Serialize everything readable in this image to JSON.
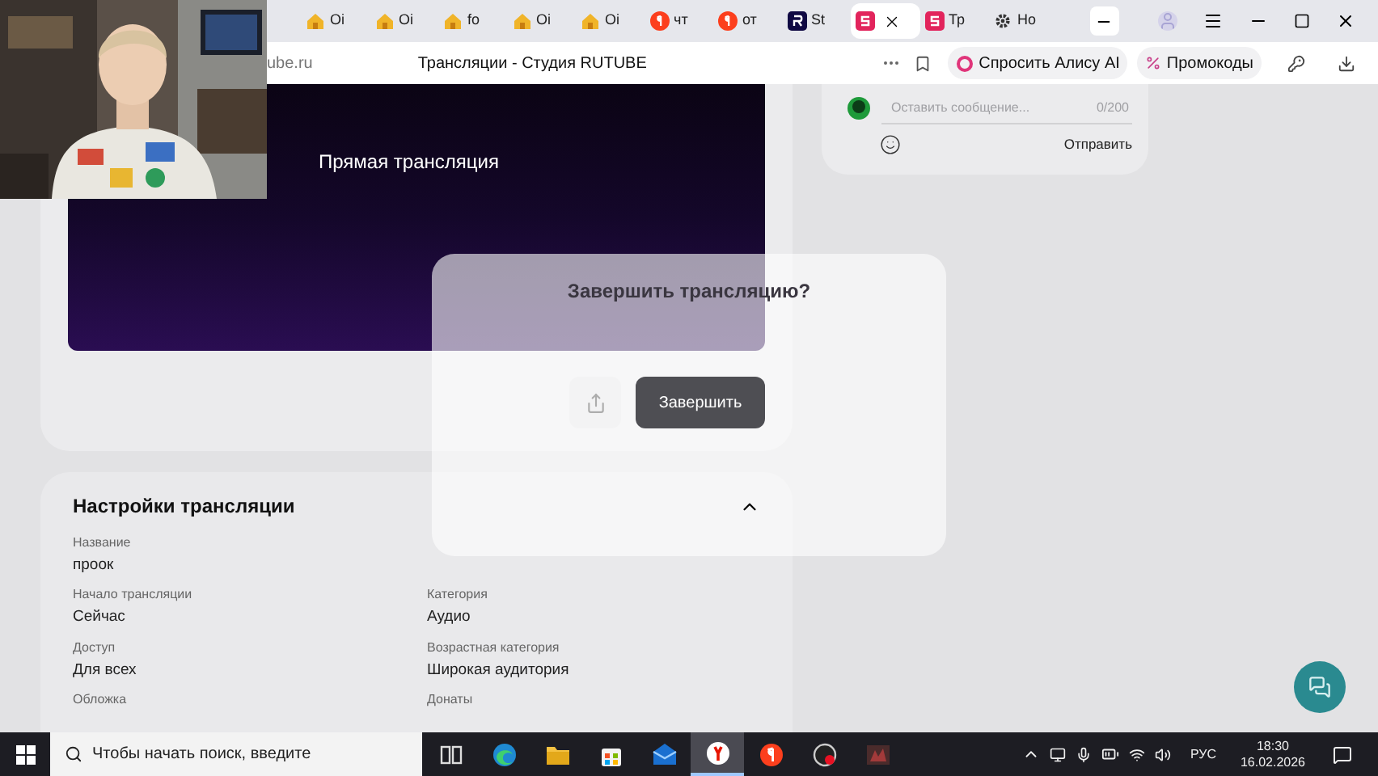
{
  "browser": {
    "tabs": [
      {
        "label": "Oi",
        "kind": "house",
        "selected": false
      },
      {
        "label": "Oi",
        "kind": "house",
        "selected": false
      },
      {
        "label": "fo",
        "kind": "house",
        "selected": false
      },
      {
        "label": "Oi",
        "kind": "house",
        "selected": false
      },
      {
        "label": "Oi",
        "kind": "house",
        "selected": false
      },
      {
        "label": "чт",
        "kind": "yandex",
        "selected": false
      },
      {
        "label": "от",
        "kind": "yandex",
        "selected": false
      },
      {
        "label": "St",
        "kind": "rutube",
        "selected": false
      },
      {
        "kind": "studio",
        "selected": true
      },
      {
        "label": "Тр",
        "kind": "studio",
        "selected": false
      },
      {
        "label": "Но",
        "kind": "gear",
        "selected": false
      }
    ],
    "address_bar": {
      "url": "ube.ru",
      "page_title": "Трансляции - Студия RUTUBE",
      "alice_button": "Спросить Алису AI",
      "promo_button": "Промокоды"
    }
  },
  "stream": {
    "preview_title": "Прямая трансляция",
    "end_button": "Завершить"
  },
  "settings": {
    "title": "Настройки трансляции",
    "expanded": true,
    "rows": [
      [
        {
          "label": "Название",
          "value": "проок"
        }
      ],
      [
        {
          "label": "Начало трансляции",
          "value": "Сейчас"
        },
        {
          "label": "Категория",
          "value": "Аудио"
        }
      ],
      [
        {
          "label": "Доступ",
          "value": "Для всех"
        },
        {
          "label": "Возрастная категория",
          "value": "Широкая аудитория"
        }
      ],
      [
        {
          "label": "Обложка"
        },
        {
          "label": "Донаты"
        }
      ]
    ]
  },
  "chat": {
    "placeholder": "Оставить сообщение...",
    "counter": "0/200",
    "send_button": "Отправить"
  },
  "dialog": {
    "title": "Завершить трансляцию?"
  },
  "taskbar": {
    "search_placeholder": "Чтобы начать поиск, введите",
    "apps": [
      {
        "kind": "task-view",
        "selected": false
      },
      {
        "kind": "edge",
        "selected": false
      },
      {
        "kind": "folder",
        "selected": false
      },
      {
        "kind": "store",
        "selected": false
      },
      {
        "kind": "mail",
        "selected": false
      },
      {
        "kind": "yandex-browser",
        "selected": true
      },
      {
        "kind": "yandex",
        "selected": false
      },
      {
        "kind": "recorder",
        "selected": false
      },
      {
        "kind": "game",
        "selected": false
      }
    ],
    "language": "РУС",
    "time": "18:30",
    "date": "16.02.2026"
  }
}
